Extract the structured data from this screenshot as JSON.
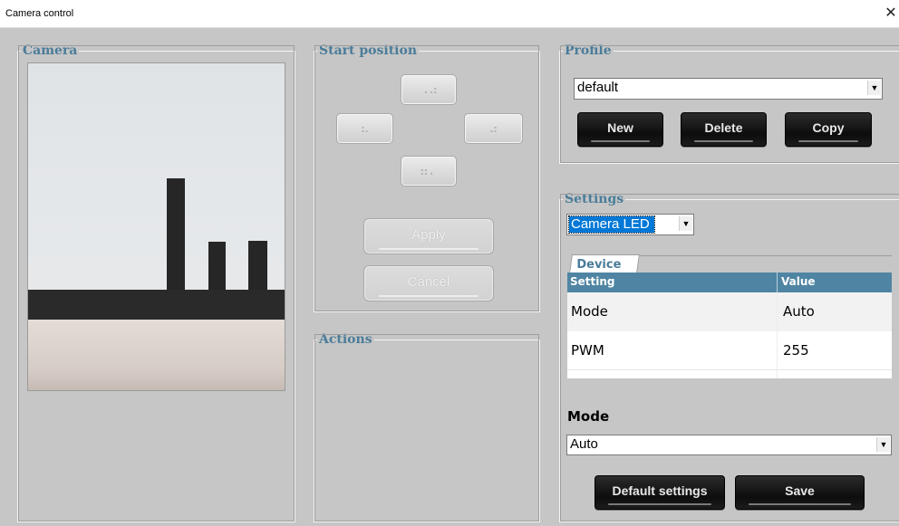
{
  "window": {
    "title": "Camera control",
    "close_glyph": "✕"
  },
  "groups": {
    "camera": "Camera",
    "start_position": "Start position",
    "actions": "Actions",
    "profile": "Profile",
    "settings": "Settings"
  },
  "start_position": {
    "up_icon": "arrow-up-icon",
    "down_icon": "arrow-down-icon",
    "left_icon": "arrow-left-icon",
    "right_icon": "arrow-right-icon",
    "up_glyph": "⠠⠴",
    "down_glyph": "⠶⠄",
    "left_glyph": "⠦",
    "right_glyph": "⠴",
    "apply_label": "Apply",
    "cancel_label": "Cancel"
  },
  "profile": {
    "selected": "default",
    "dropdown_glyph": "▼",
    "new_label": "New",
    "delete_label": "Delete",
    "copy_label": "Copy"
  },
  "settings": {
    "category_selected": "Camera LED",
    "dropdown_glyph": "▼",
    "tab_label": "Device",
    "columns": [
      "Setting",
      "Value"
    ],
    "rows": [
      {
        "setting": "Mode",
        "value": "Auto"
      },
      {
        "setting": "PWM",
        "value": "255"
      }
    ],
    "mode_label": "Mode",
    "mode_selected": "Auto",
    "default_settings_label": "Default settings",
    "save_label": "Save"
  },
  "colors": {
    "window_bg": "#c6c6c6",
    "group_title": "#4a7c99",
    "grid_header": "#4f85a3",
    "selection": "#0078d7",
    "dark_button": "#0d0d0d"
  }
}
